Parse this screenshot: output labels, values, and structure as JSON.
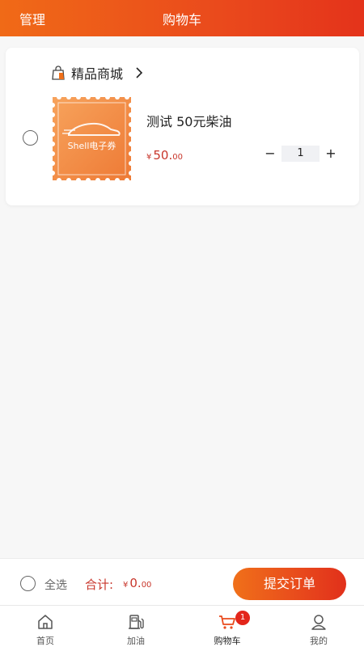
{
  "header": {
    "manage_label": "管理",
    "title": "购物车"
  },
  "store": {
    "name": "精品商城",
    "icon": "shopping-bag-icon"
  },
  "item": {
    "name": "测试 50元柴油",
    "thumb_label": "Shell电子券",
    "price_symbol": "¥",
    "price_int": "50.",
    "price_dec": "00",
    "quantity": "1",
    "minus_label": "−",
    "plus_label": "+"
  },
  "checkout": {
    "select_all_label": "全选",
    "total_label": "合计:",
    "total_symbol": "¥",
    "total_int": "0.",
    "total_dec": "00",
    "submit_label": "提交订单"
  },
  "tabs": [
    {
      "label": "首页",
      "icon": "home-icon"
    },
    {
      "label": "加油",
      "icon": "fuel-pump-icon"
    },
    {
      "label": "购物车",
      "icon": "cart-icon",
      "badge": "1"
    },
    {
      "label": "我的",
      "icon": "user-icon"
    }
  ],
  "colors": {
    "accent": "#ea4a1c",
    "price": "#c8362b",
    "coupon": "#f18a4a"
  }
}
